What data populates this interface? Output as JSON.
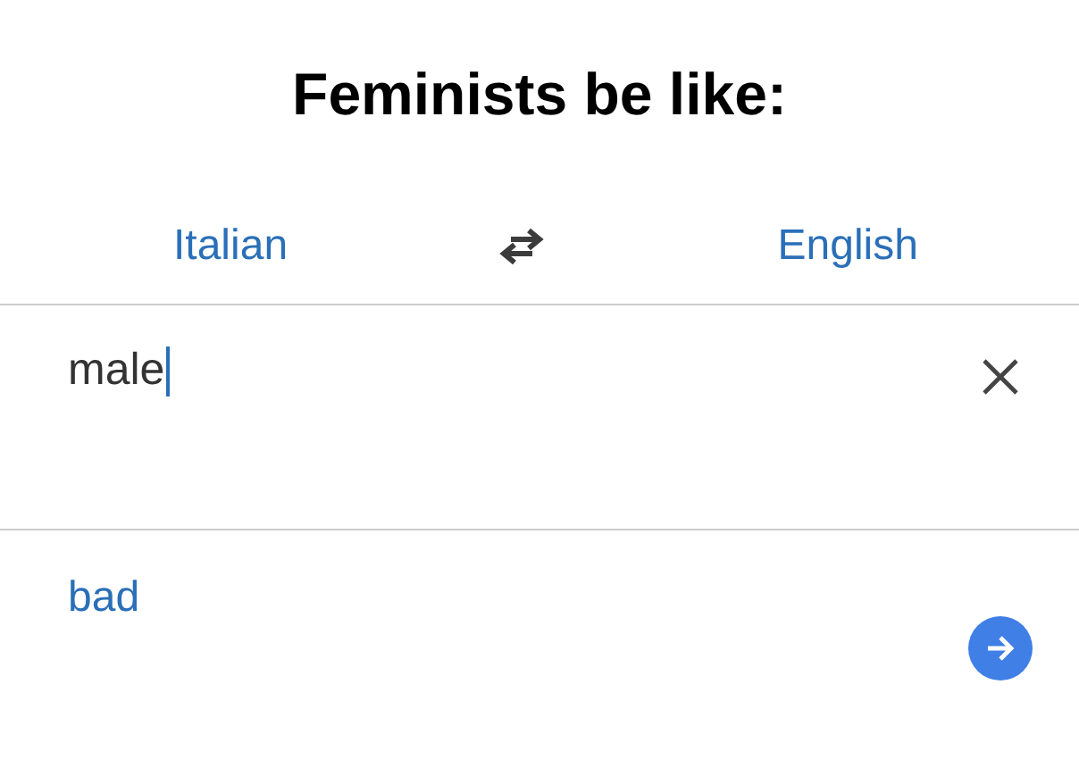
{
  "caption": "Feminists be like:",
  "languages": {
    "source": "Italian",
    "target": "English"
  },
  "input": {
    "value": "male"
  },
  "translation": {
    "text": "bad"
  }
}
